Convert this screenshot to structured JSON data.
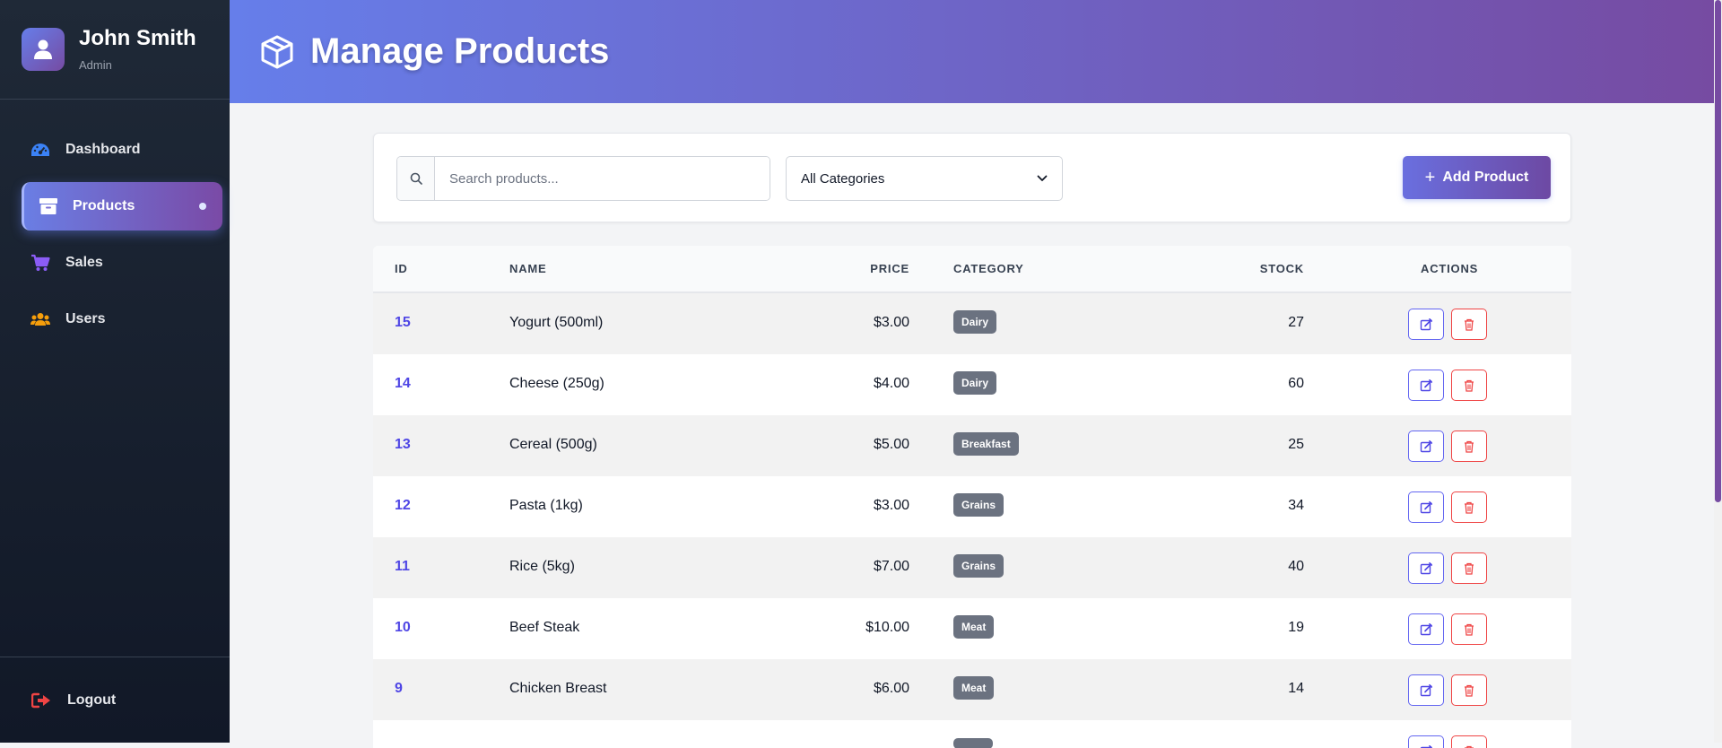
{
  "user": {
    "name": "John Smith",
    "role": "Admin"
  },
  "nav": {
    "items": [
      {
        "label": "Dashboard",
        "icon": "gauge-icon",
        "color": "#3b82f6"
      },
      {
        "label": "Products",
        "icon": "box-icon",
        "active": true
      },
      {
        "label": "Sales",
        "icon": "cart-icon",
        "color": "#8b5cf6"
      },
      {
        "label": "Users",
        "icon": "users-icon",
        "color": "#f59e0b"
      }
    ],
    "logout_label": "Logout"
  },
  "header": {
    "title": "Manage Products",
    "icon": "box-icon"
  },
  "toolbar": {
    "search_placeholder": "Search products...",
    "category_selected": "All Categories",
    "add_label": "Add Product"
  },
  "table": {
    "headers": {
      "id": "ID",
      "name": "NAME",
      "price": "PRICE",
      "category": "CATEGORY",
      "stock": "STOCK",
      "actions": "ACTIONS"
    },
    "rows": [
      {
        "id": "15",
        "name": "Yogurt (500ml)",
        "price": "$3.00",
        "category": "Dairy",
        "stock": "27"
      },
      {
        "id": "14",
        "name": "Cheese (250g)",
        "price": "$4.00",
        "category": "Dairy",
        "stock": "60"
      },
      {
        "id": "13",
        "name": "Cereal (500g)",
        "price": "$5.00",
        "category": "Breakfast",
        "stock": "25"
      },
      {
        "id": "12",
        "name": "Pasta (1kg)",
        "price": "$3.00",
        "category": "Grains",
        "stock": "34"
      },
      {
        "id": "11",
        "name": "Rice (5kg)",
        "price": "$7.00",
        "category": "Grains",
        "stock": "40"
      },
      {
        "id": "10",
        "name": "Beef Steak",
        "price": "$10.00",
        "category": "Meat",
        "stock": "19"
      },
      {
        "id": "9",
        "name": "Chicken Breast",
        "price": "$6.00",
        "category": "Meat",
        "stock": "14"
      },
      {
        "id": "",
        "name": "",
        "price": "",
        "category": "",
        "stock": ""
      }
    ]
  },
  "colors": {
    "accent_start": "#667eea",
    "accent_end": "#764ba2",
    "sidebar_bg": "#1f2937",
    "edit": "#6366f1",
    "delete": "#ef4444"
  }
}
